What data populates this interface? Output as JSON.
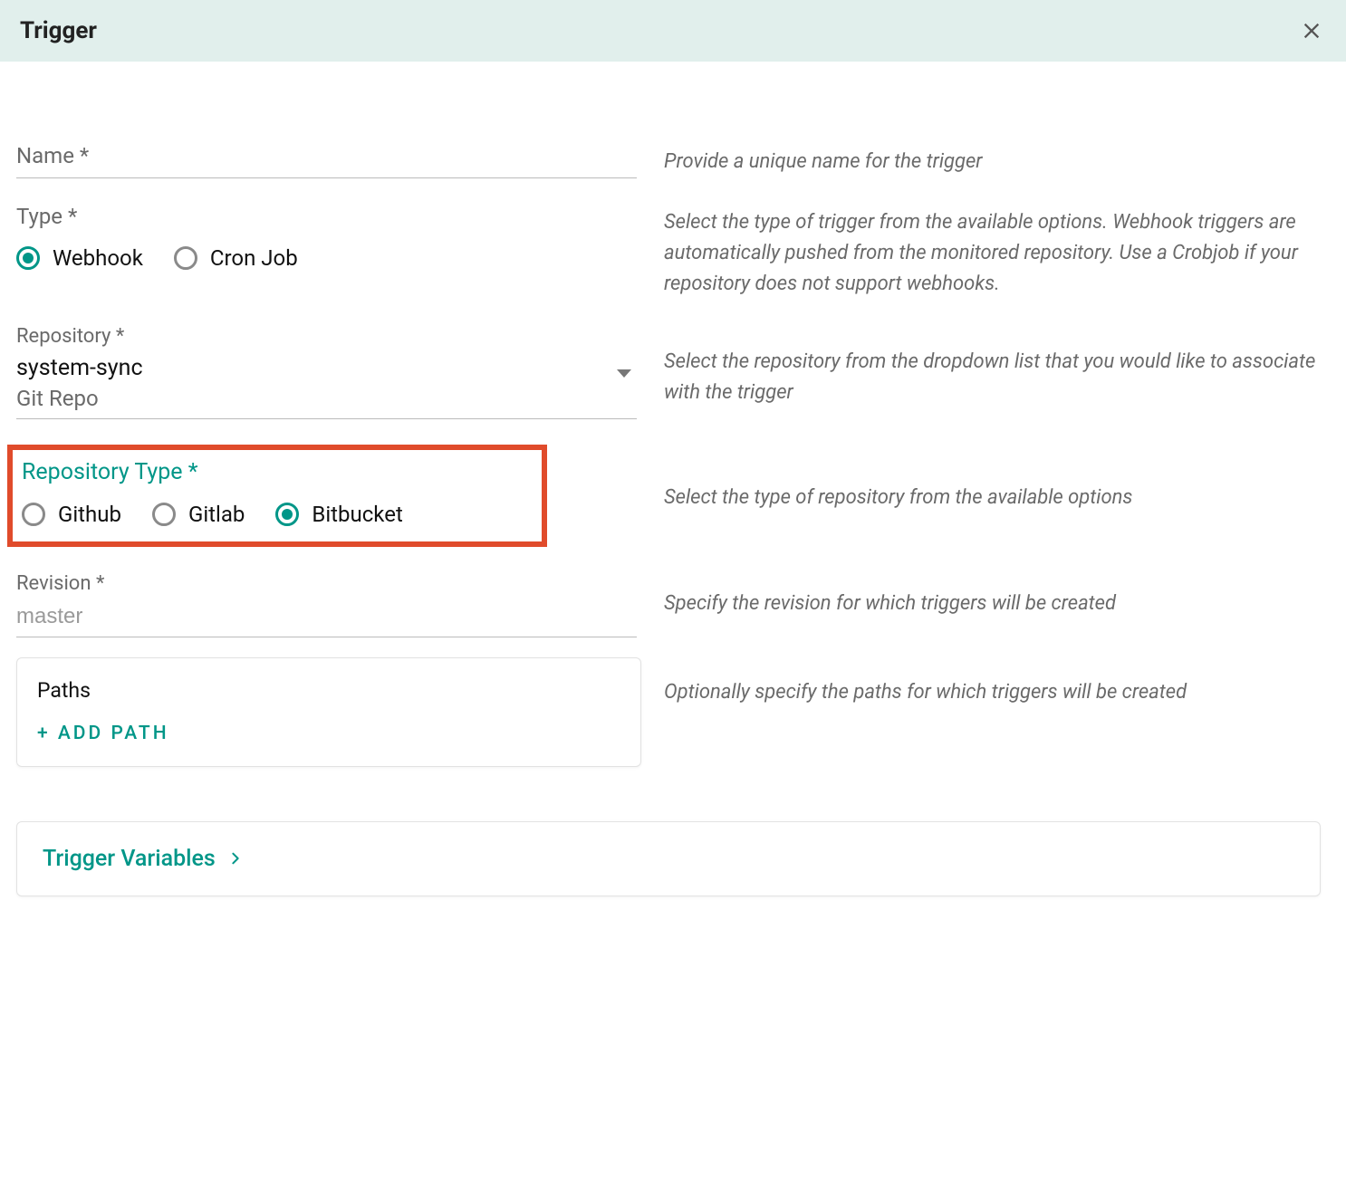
{
  "header": {
    "title": "Trigger"
  },
  "name": {
    "label": "Name *",
    "value": "",
    "help": "Provide a unique name for the trigger"
  },
  "type": {
    "label": "Type *",
    "options": [
      "Webhook",
      "Cron Job"
    ],
    "selected": "Webhook",
    "help": "Select the type of trigger from the available options. Webhook triggers are automatically pushed from the monitored repository. Use a Crobjob if your repository does not support webhooks."
  },
  "repository": {
    "label": "Repository *",
    "selected_value": "system-sync",
    "selected_sub": "Git Repo",
    "help": "Select the repository from the dropdown list that you would like to associate with the trigger"
  },
  "repository_type": {
    "label": "Repository Type *",
    "options": [
      "Github",
      "Gitlab",
      "Bitbucket"
    ],
    "selected": "Bitbucket",
    "help": "Select the type of repository from the available options"
  },
  "revision": {
    "label": "Revision *",
    "placeholder": "master",
    "value": "",
    "help": "Specify the revision for which triggers will be created"
  },
  "paths": {
    "title": "Paths",
    "add_label": "+ ADD PATH",
    "help": "Optionally specify the paths for which triggers will be created"
  },
  "variables": {
    "title": "Trigger Variables"
  }
}
